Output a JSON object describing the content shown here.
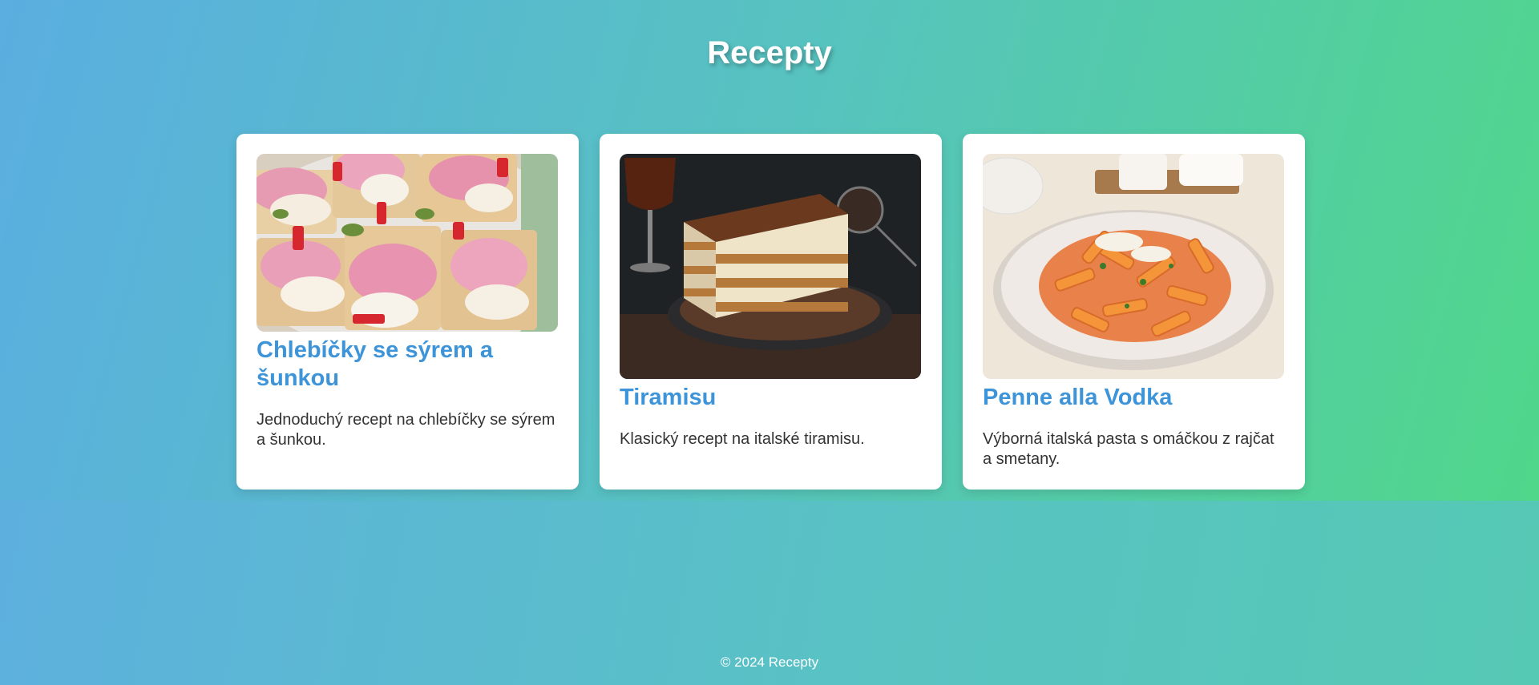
{
  "header": {
    "title": "Recepty"
  },
  "recipes": [
    {
      "title": "Chlebíčky se sýrem a šunkou",
      "description": "Jednoduchý recept na chlebíčky se sýrem a šunkou.",
      "image_icon": "open-sandwich-photo"
    },
    {
      "title": "Tiramisu",
      "description": "Klasický recept na italské tiramisu.",
      "image_icon": "tiramisu-photo"
    },
    {
      "title": "Penne alla Vodka",
      "description": "Výborná italská pasta s omáčkou z rajčat a smetany.",
      "image_icon": "penne-pasta-photo"
    }
  ],
  "footer": {
    "text": "© 2024 Recepty"
  },
  "colors": {
    "accent": "#3d94d8",
    "card_bg": "#ffffff",
    "text": "#333333"
  }
}
